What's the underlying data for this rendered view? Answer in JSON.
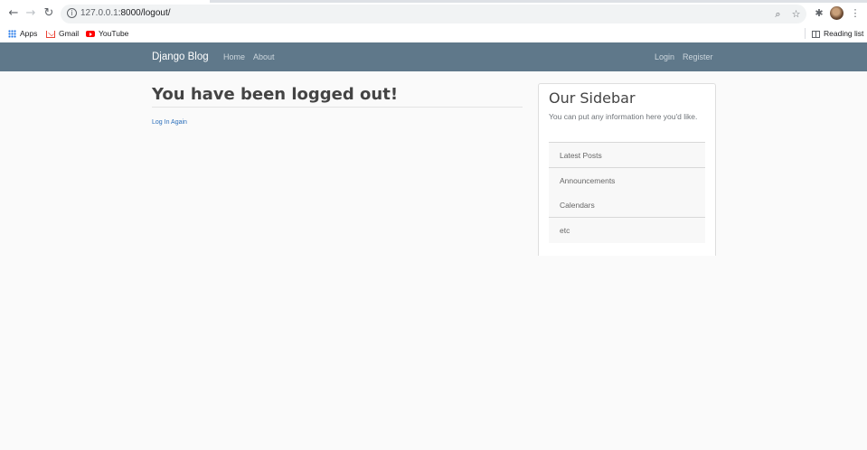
{
  "browser": {
    "url_host": "127.0.0.1",
    "url_rest": ":8000/logout/",
    "bookmarks": [
      {
        "label": "Apps"
      },
      {
        "label": "Gmail"
      },
      {
        "label": "YouTube"
      }
    ],
    "reading_list_label": "Reading list"
  },
  "navbar": {
    "brand": "Django Blog",
    "left_links": [
      "Home",
      "About"
    ],
    "right_links": [
      "Login",
      "Register"
    ],
    "background": "#5f788a"
  },
  "main": {
    "title": "You have been logged out!",
    "login_again_link": "Log In Again"
  },
  "sidebar": {
    "title": "Our Sidebar",
    "text": "You can put any information here you'd like.",
    "items": [
      "Latest Posts",
      "Announcements",
      "Calendars",
      "etc"
    ]
  }
}
